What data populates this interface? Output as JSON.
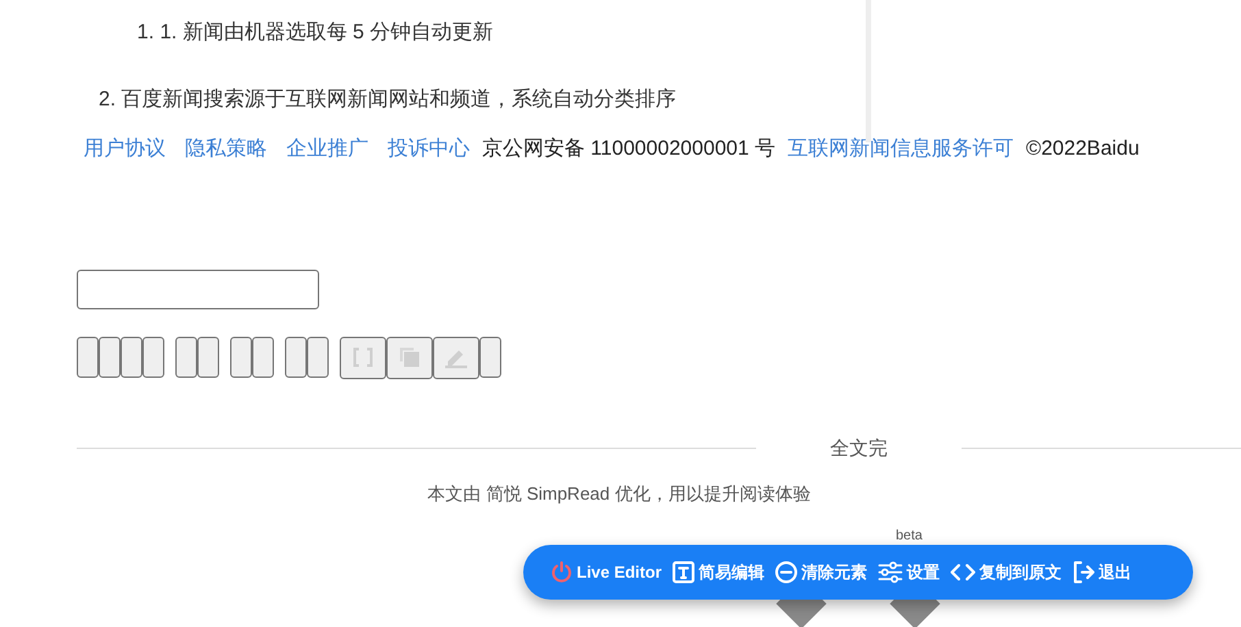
{
  "list": [
    {
      "marker": "1.",
      "text": "1. 新闻由机器选取每 5 分钟自动更新",
      "kind": "nested"
    },
    {
      "marker": "2.",
      "text": "百度新闻搜索源于互联网新闻网站和频道，系统自动分类排序",
      "kind": "top"
    }
  ],
  "footer": [
    {
      "text": "用户协议",
      "kind": "link"
    },
    {
      "text": "隐私策略",
      "kind": "link"
    },
    {
      "text": "企业推广",
      "kind": "link"
    },
    {
      "text": "投诉中心",
      "kind": "link"
    },
    {
      "text": "京公网安备 11000002000001 号",
      "kind": "text"
    },
    {
      "text": "互联网新闻信息服务许可",
      "kind": "link"
    },
    {
      "text": "©2022Baidu",
      "kind": "text"
    }
  ],
  "button_groups": [
    [
      {
        "kind": "blank"
      },
      {
        "kind": "blank"
      },
      {
        "kind": "blank"
      },
      {
        "kind": "blank"
      }
    ],
    [
      {
        "kind": "blank"
      },
      {
        "kind": "blank"
      }
    ],
    [
      {
        "kind": "blank"
      },
      {
        "kind": "blank"
      }
    ],
    [
      {
        "kind": "blank"
      },
      {
        "kind": "blank"
      }
    ],
    [
      {
        "kind": "brackets"
      },
      {
        "kind": "copy"
      },
      {
        "kind": "pen"
      },
      {
        "kind": "blank"
      }
    ]
  ],
  "end_label": "全文完",
  "credit": "本文由 简悦 SimpRead 优化，用以提升阅读体验",
  "hidden_line_peek": "beta",
  "toolbar": [
    {
      "kind": "power",
      "label": "Live Editor"
    },
    {
      "kind": "text",
      "label": "简易编辑"
    },
    {
      "kind": "minus",
      "label": "清除元素"
    },
    {
      "kind": "sliders",
      "label": "设置"
    },
    {
      "kind": "code",
      "label": "复制到原文"
    },
    {
      "kind": "exit",
      "label": "退出"
    }
  ]
}
